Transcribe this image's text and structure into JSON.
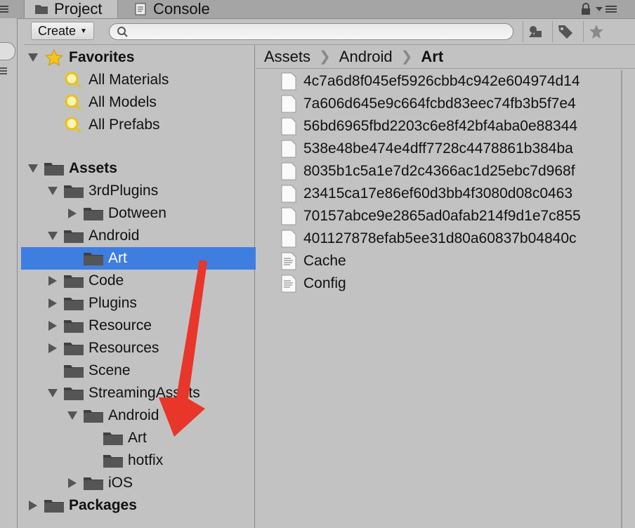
{
  "tabs": [
    {
      "label": "Project",
      "icon": "folder-icon"
    },
    {
      "label": "Console",
      "icon": "console-icon"
    }
  ],
  "toolbar": {
    "create_label": "Create",
    "search_placeholder": "",
    "icons": [
      "filter-type-icon",
      "filter-label-icon",
      "favorite-star-icon"
    ]
  },
  "tree": {
    "favorites": {
      "label": "Favorites",
      "items": [
        "All Materials",
        "All Models",
        "All Prefabs"
      ]
    },
    "assets": {
      "label": "Assets",
      "items": [
        {
          "label": "3rdPlugins",
          "depth": 1,
          "state": "expanded"
        },
        {
          "label": "Dotween",
          "depth": 2,
          "state": "collapsed"
        },
        {
          "label": "Android",
          "depth": 1,
          "state": "expanded"
        },
        {
          "label": "Art",
          "depth": 2,
          "state": "selected"
        },
        {
          "label": "Code",
          "depth": 1,
          "state": "collapsed"
        },
        {
          "label": "Plugins",
          "depth": 1,
          "state": "collapsed"
        },
        {
          "label": "Resource",
          "depth": 1,
          "state": "collapsed"
        },
        {
          "label": "Resources",
          "depth": 1,
          "state": "collapsed"
        },
        {
          "label": "Scene",
          "depth": 1,
          "state": "leaf"
        },
        {
          "label": "StreamingAssets",
          "depth": 1,
          "state": "expanded"
        },
        {
          "label": "Android",
          "depth": 2,
          "state": "expanded"
        },
        {
          "label": "Art",
          "depth": 3,
          "state": "leaf"
        },
        {
          "label": "hotfix",
          "depth": 3,
          "state": "leaf"
        },
        {
          "label": "iOS",
          "depth": 2,
          "state": "collapsed"
        }
      ]
    },
    "packages": {
      "label": "Packages"
    }
  },
  "breadcrumb": [
    "Assets",
    "Android",
    "Art"
  ],
  "files": [
    {
      "name": "4c7a6d8f045ef5926cbb4c942e604974d14",
      "kind": "blank"
    },
    {
      "name": "7a606d645e9c664fcbd83eec74fb3b5f7e4",
      "kind": "blank"
    },
    {
      "name": "56bd6965fbd2203c6e8f42bf4aba0e88344",
      "kind": "blank"
    },
    {
      "name": "538e48be474e4dff7728c4478861b384ba",
      "kind": "blank"
    },
    {
      "name": "8035b1c5a1e7d2c4366ac1d25ebc7d968f",
      "kind": "blank"
    },
    {
      "name": "23415ca17e86ef60d3bb4f3080d08c0463",
      "kind": "blank"
    },
    {
      "name": "70157abce9e2865ad0afab214f9d1e7c855",
      "kind": "blank"
    },
    {
      "name": "401127878efab5ee31d80a60837b04840c",
      "kind": "blank"
    },
    {
      "name": "Cache",
      "kind": "text"
    },
    {
      "name": "Config",
      "kind": "text"
    }
  ],
  "colors": {
    "selection": "#3e7ee0",
    "annotation_arrow": "#e8362a",
    "panel_bg": "#c2c2c2"
  }
}
